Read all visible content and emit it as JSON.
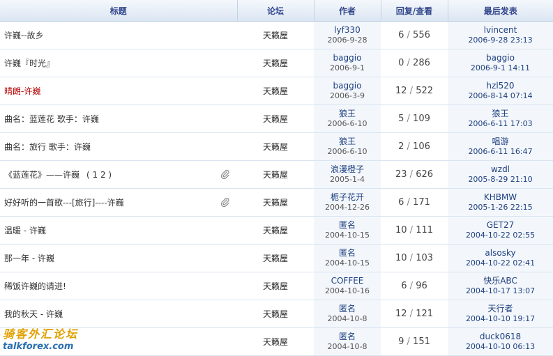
{
  "headers": {
    "title": "标题",
    "forum": "论坛",
    "author": "作者",
    "replies": "回复/查看",
    "last": "最后发表"
  },
  "rows": [
    {
      "title": "许巍--故乡",
      "hot": false,
      "clip": false,
      "forum": "天籁屋",
      "author": "lyf330",
      "author_date": "2006-9-28",
      "replies": "6",
      "views": "556",
      "last_user": "lvincent",
      "last_date": "2006-9-28 23:13"
    },
    {
      "title": "许巍『时光』",
      "hot": false,
      "clip": false,
      "forum": "天籁屋",
      "author": "baggio",
      "author_date": "2006-9-1",
      "replies": "0",
      "views": "286",
      "last_user": "baggio",
      "last_date": "2006-9-1 14:11"
    },
    {
      "title": "晴朗-许巍",
      "hot": true,
      "clip": false,
      "forum": "天籁屋",
      "author": "baggio",
      "author_date": "2006-3-9",
      "replies": "12",
      "views": "522",
      "last_user": "hzl520",
      "last_date": "2006-8-14 07:14"
    },
    {
      "title": "曲名：蓝莲花 歌手：许巍",
      "hot": false,
      "clip": false,
      "forum": "天籁屋",
      "author": "狼王",
      "author_date": "2006-6-10",
      "replies": "5",
      "views": "109",
      "last_user": "狼王",
      "last_date": "2006-6-11 17:03"
    },
    {
      "title": "曲名：旅行 歌手：许巍",
      "hot": false,
      "clip": false,
      "forum": "天籁屋",
      "author": "狼王",
      "author_date": "2006-6-10",
      "replies": "2",
      "views": "106",
      "last_user": "唱游",
      "last_date": "2006-6-11 16:47"
    },
    {
      "title": "《蓝莲花》——许巍",
      "pages": "( 1 2 )",
      "hot": false,
      "clip": true,
      "forum": "天籁屋",
      "author": "浪漫橙子",
      "author_date": "2005-1-4",
      "replies": "23",
      "views": "626",
      "last_user": "wzdl",
      "last_date": "2005-8-29 21:10"
    },
    {
      "title": "好好听的一首歌---[旅行]----许巍",
      "hot": false,
      "clip": true,
      "forum": "天籁屋",
      "author": "栀子花开",
      "author_date": "2004-12-26",
      "replies": "6",
      "views": "171",
      "last_user": "KHBMW",
      "last_date": "2005-1-26 22:15"
    },
    {
      "title": "温暖 - 许巍",
      "hot": false,
      "clip": false,
      "forum": "天籁屋",
      "author": "匿名",
      "author_date": "2004-10-15",
      "replies": "10",
      "views": "111",
      "last_user": "GET27",
      "last_date": "2004-10-22 02:55"
    },
    {
      "title": "那一年 - 许巍",
      "hot": false,
      "clip": false,
      "forum": "天籁屋",
      "author": "匿名",
      "author_date": "2004-10-15",
      "replies": "10",
      "views": "103",
      "last_user": "alsosky",
      "last_date": "2004-10-22 02:41"
    },
    {
      "title": "稀饭许巍的请进!",
      "hot": false,
      "clip": false,
      "forum": "天籁屋",
      "author": "COFFEE",
      "author_date": "2004-10-16",
      "replies": "6",
      "views": "96",
      "last_user": "快乐ABC",
      "last_date": "2004-10-17 13:07"
    },
    {
      "title": "我的秋天 - 许巍",
      "hot": false,
      "clip": false,
      "forum": "天籁屋",
      "author": "匿名",
      "author_date": "2004-10-8",
      "replies": "12",
      "views": "121",
      "last_user": "天行者",
      "last_date": "2004-10-10 19:17"
    },
    {
      "title": "",
      "hot": false,
      "clip": false,
      "forum": "天籁屋",
      "author": "匿名",
      "author_date": "2004-10-8",
      "replies": "9",
      "views": "151",
      "last_user": "duck0618",
      "last_date": "2004-10-10 06:13"
    }
  ],
  "watermark": {
    "cn": "骑客外汇论坛",
    "en": "talkforex.com"
  },
  "colors": {
    "header_text": "#33478c",
    "link": "#1e3f80",
    "hot_title": "#b50000"
  }
}
